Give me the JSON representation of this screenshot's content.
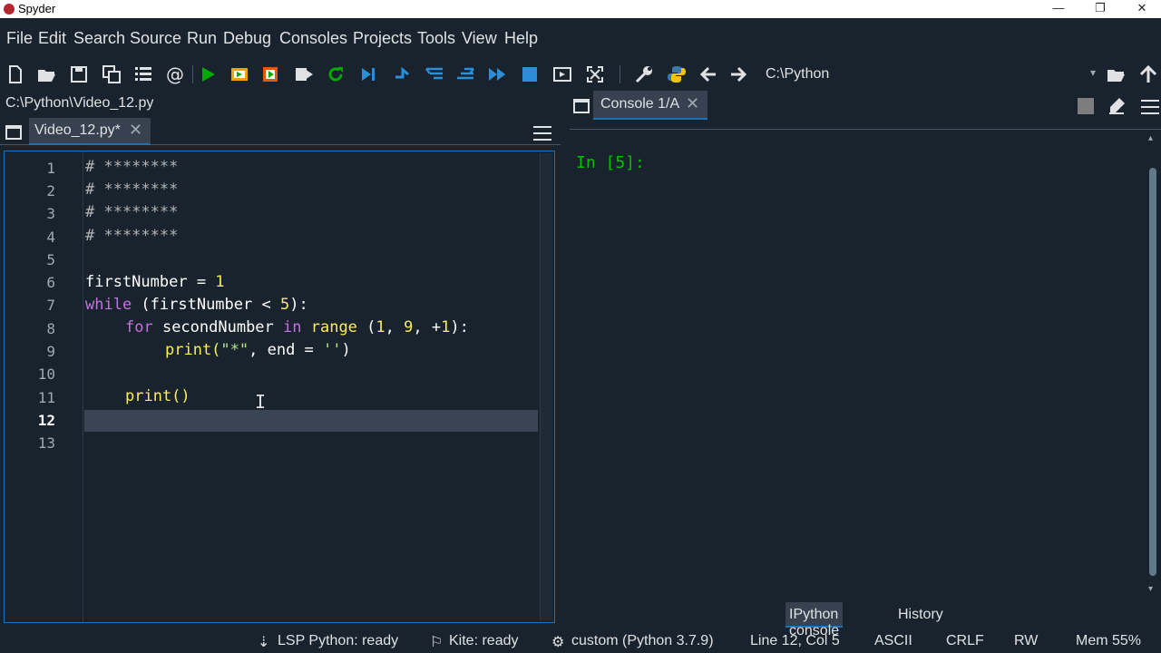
{
  "window": {
    "title": "Spyder",
    "controls": {
      "minimize": "—",
      "restore": "❐",
      "close": "✕"
    }
  },
  "menu": [
    "File",
    "Edit",
    "Search",
    "Source",
    "Run",
    "Debug",
    "Consoles",
    "Projects",
    "Tools",
    "View",
    "Help"
  ],
  "toolbar": {
    "icons": [
      "new-file-icon",
      "open-file-icon",
      "save-icon",
      "save-all-icon",
      "outline-icon",
      "at-icon",
      "run-icon",
      "run-cell-icon",
      "run-cell-advance-icon",
      "run-selection-icon",
      "rerun-icon",
      "debug-icon",
      "step-icon",
      "step-into-icon",
      "step-return-icon",
      "continue-icon",
      "stop-icon",
      "maximize-pane-icon",
      "fullscreen-icon",
      "preferences-icon",
      "python-path-icon",
      "back-arrow-icon",
      "forward-arrow-icon"
    ],
    "working_directory": "C:\\Python",
    "colors": {
      "run": "#00aa00",
      "blue": "#2a8fd6",
      "orange": "#f2a000"
    }
  },
  "editor": {
    "file_path": "C:\\Python\\Video_12.py",
    "tab_label": "Video_12.py*",
    "tab_close": "✕",
    "current_line": 12,
    "line_numbers": [
      "1",
      "2",
      "3",
      "4",
      "5",
      "6",
      "7",
      "8",
      "9",
      "10",
      "11",
      "12",
      "13"
    ],
    "code": {
      "l1": "# ********",
      "l2": "# ********",
      "l3": "# ********",
      "l4": "# ********",
      "l6_var": "firstNumber = ",
      "l6_num": "1",
      "l7_kw": "while",
      "l7_a": " (firstNumber < ",
      "l7_num": "5",
      "l7_b": "):",
      "l8_kw": "for",
      "l8_var": " secondNumber ",
      "l8_kw2": "in",
      "l8_range": " range ",
      "l8_paren": "(",
      "l8_n1": "1",
      "l8_c1": ", ",
      "l8_n2": "9",
      "l8_c2": ", +",
      "l8_n3": "1",
      "l8_end": "):",
      "l9_fn": "print(",
      "l9_str": "\"*\"",
      "l9_mid": ", end = ",
      "l9_str2": "''",
      "l9_end": ")",
      "l11": "print()"
    }
  },
  "console": {
    "tab_label": "Console 1/A",
    "tab_close": "✕",
    "prompt": "In [5]:",
    "bottom_tabs": [
      "IPython console",
      "History"
    ]
  },
  "statusbar": {
    "lsp": "LSP Python: ready",
    "kite": "Kite: ready",
    "env": "custom (Python 3.7.9)",
    "position": "Line 12, Col 5",
    "encoding": "ASCII",
    "eol": "CRLF",
    "permissions": "RW",
    "memory": "Mem 55%"
  }
}
